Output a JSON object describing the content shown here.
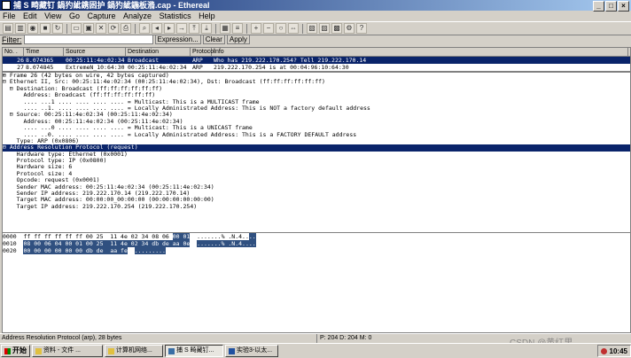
{
  "window": {
    "title": "捕 S 畸藏钉 鍋犳紪鎸囦护 鍋犳紪鍦板潃.cap - Ethereal",
    "controls": [
      "_",
      "□",
      "×"
    ]
  },
  "menu": [
    "File",
    "Edit",
    "View",
    "Go",
    "Capture",
    "Analyze",
    "Statistics",
    "Help"
  ],
  "filter": {
    "label": "Filter:",
    "value": "",
    "expression": "Expression...",
    "clear": "Clear",
    "apply": "Apply"
  },
  "packet_list": {
    "columns": [
      "No. .",
      "Time",
      "Source",
      "Destination",
      "Protocol",
      "Info"
    ],
    "rows": [
      {
        "no": "26",
        "time": "8.074365",
        "src": "00:25:11:4e:02:34",
        "dst": "Broadcast",
        "proto": "ARP",
        "info": "Who has 219.222.170.254? Tell 219.222.170.14"
      },
      {
        "no": "27",
        "time": "8.074845",
        "src": "ExtremeN_10:64:30",
        "dst": "00:25:11:4e:02:34",
        "proto": "ARP",
        "info": "219.222.170.254 is at 00:04:96:10:64:30"
      }
    ]
  },
  "details": [
    "⊞ Frame 26 (42 bytes on wire, 42 bytes captured)",
    "⊟ Ethernet II, Src: 00:25:11:4e:02:34 (00:25:11:4e:02:34), Dst: Broadcast (ff:ff:ff:ff:ff:ff)",
    "  ⊟ Destination: Broadcast (ff:ff:ff:ff:ff:ff)",
    "      Address: Broadcast (ff:ff:ff:ff:ff:ff)",
    "      .... ...1 .... .... .... .... = Multicast: This is a MULTICAST frame",
    "      .... ..1. .... .... .... .... = Locally Administrated Address: This is NOT a factory default address",
    "  ⊟ Source: 00:25:11:4e:02:34 (00:25:11:4e:02:34)",
    "      Address: 00:25:11:4e:02:34 (00:25:11:4e:02:34)",
    "      .... ...0 .... .... .... .... = Multicast: This is a UNICAST frame",
    "      .... ..0. .... .... .... .... = Locally Administrated Address: This is a FACTORY DEFAULT address",
    "    Type: ARP (0x0806)",
    "⊟ Address Resolution Protocol (request)",
    "    Hardware type: Ethernet (0x0001)",
    "    Protocol type: IP (0x0800)",
    "    Hardware size: 6",
    "    Protocol size: 4",
    "    Opcode: request (0x0001)",
    "    Sender MAC address: 00:25:11:4e:02:34 (00:25:11:4e:02:34)",
    "    Sender IP address: 219.222.170.14 (219.222.170.14)",
    "    Target MAC address: 00:00:00_00:00:00 (00:00:00:00:00:00)",
    "    Target IP address: 219.222.170.254 (219.222.170.254)"
  ],
  "hex": [
    {
      "offset": "0000",
      "plain": "ff ff ff ff ff ff 00 25  11 4e 02 34 08 06 ",
      "hl": "00 01",
      "ascii_plain": "  .......% .N.4..",
      "ascii_hl": ".."
    },
    {
      "offset": "0010",
      "plain": "",
      "hl": "08 00 06 04 00 01 00 25  11 4e 02 34 db de aa 0e",
      "ascii_plain": "  ",
      "ascii_hl": ".......% .N.4...."
    },
    {
      "offset": "0020",
      "plain": "",
      "hl": "00 00 00 00 00 00 db de  aa fe",
      "ascii_plain": "  ",
      "ascii_hl": "........."
    }
  ],
  "status": {
    "left": "Address Resolution Protocol (arp), 28 bytes",
    "right": "P: 204 D: 204 M: 0"
  },
  "taskbar": {
    "start": "开始",
    "tasks": [
      "资料 - 文件 ...",
      "计算机网络...",
      "捕 S 畸藏钉...",
      "实验3-以太..."
    ],
    "clock": "10:45",
    "watermark": "CSDN @黄红里"
  }
}
